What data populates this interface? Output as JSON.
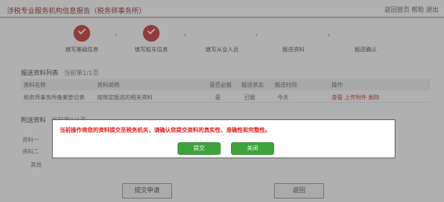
{
  "header": {
    "title": "涉税专业服务机构信息报告（税务师事务所）",
    "right": "返回首页 帮助 退出"
  },
  "steps": [
    {
      "label": "填写基础信息",
      "status": "done"
    },
    {
      "label": "填写股东信息",
      "status": "done"
    },
    {
      "label": "填写从业人员",
      "status": "pending"
    },
    {
      "label": "报送资料",
      "status": "pending"
    },
    {
      "label": "报送确认",
      "status": "pending"
    }
  ],
  "step_sep": "›",
  "report_section": {
    "title": "报送资料列表",
    "sub": "当前第1/1页"
  },
  "table": {
    "headers": [
      "资料名称",
      "资料说明",
      "是否必报",
      "报送状态",
      "报送时间",
      "操作"
    ],
    "row": [
      "税务师事务所备案登记表",
      "按规定报送的相关资料",
      "是",
      "已报",
      "今天",
      "查看 上传附件 删除"
    ]
  },
  "attach_section": {
    "title": "附送资料",
    "sub": "当前第1/1页"
  },
  "attach_items": [
    "资料一",
    "资料二",
    "其他"
  ],
  "bottom_buttons": {
    "submit": "提交申请",
    "back": "返回"
  },
  "dialog": {
    "message": "当前操作将您的资料提交至税务机关，请确认您提交资料的真实性、准确性和完整性。",
    "confirm": "提交",
    "close": "关闭"
  },
  "colors": {
    "accent": "#c62a2a",
    "confirm_button": "#3fa33d",
    "message": "#e01b1b"
  }
}
